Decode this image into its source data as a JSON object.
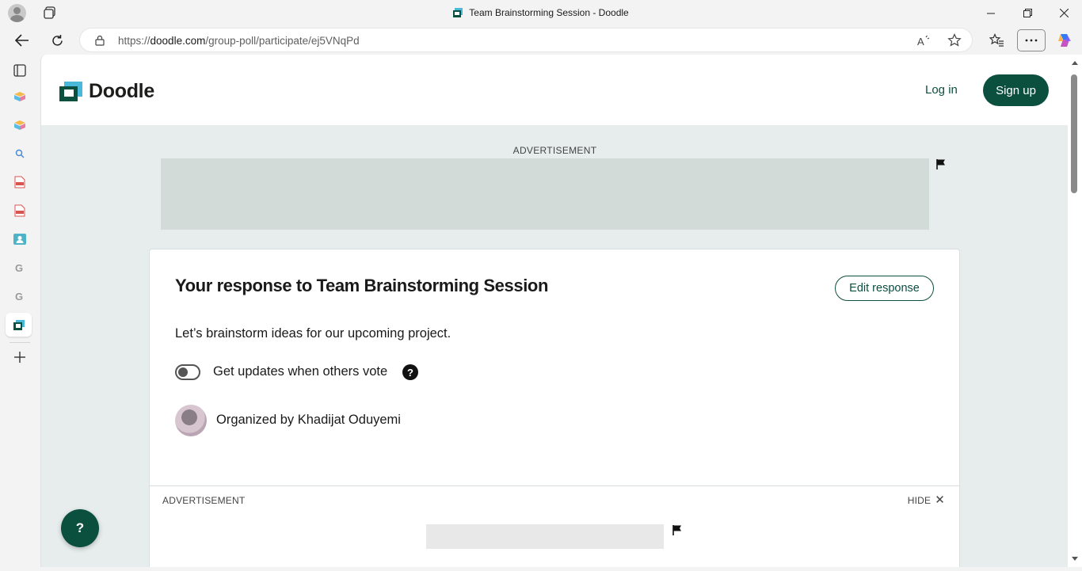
{
  "browser": {
    "window_title": "Team Brainstorming Session - Doodle",
    "url_prefix": "https://",
    "url_domain": "doodle.com",
    "url_path": "/group-poll/participate/ej5VNqPd"
  },
  "site": {
    "logo_text": "Doodle",
    "login_label": "Log in",
    "signup_label": "Sign up",
    "brand_color": "#0b4f3f"
  },
  "ads": {
    "top_label": "ADVERTISEMENT",
    "bottom_label": "ADVERTISEMENT",
    "hide_label": "HIDE"
  },
  "poll": {
    "title": "Your response to Team Brainstorming Session",
    "edit_label": "Edit response",
    "description": "Let’s brainstorm ideas for our upcoming project.",
    "updates_toggle_label": "Get updates when others vote",
    "updates_toggle_on": false,
    "help_glyph": "?",
    "organizer_text": "Organized by Khadijat Oduyemi"
  },
  "help_fab_glyph": "?"
}
